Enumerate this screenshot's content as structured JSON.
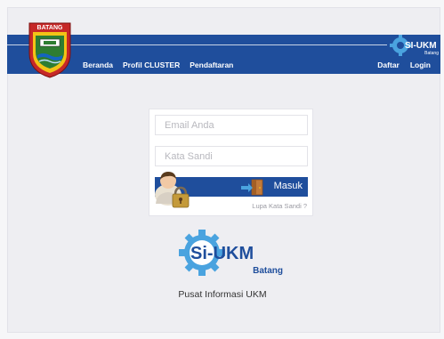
{
  "header": {
    "emblem_text": "BATANG",
    "nav": [
      "Beranda",
      "Profil CLUSTER",
      "Pendaftaran"
    ],
    "nav_right": [
      "Daftar",
      "Login"
    ],
    "brand_small": "SI-UKM",
    "brand_small_sub": "Batang",
    "bar_color": "#1f4e9c"
  },
  "login": {
    "email_placeholder": "Email Anda",
    "password_placeholder": "Kata Sandi",
    "submit_label": "Masuk",
    "forgot_label": "Lupa Kata Sandi ?"
  },
  "logo": {
    "name": "Si-UKM",
    "sub": "Batang",
    "tagline": "Pusat Informasi UKM"
  }
}
